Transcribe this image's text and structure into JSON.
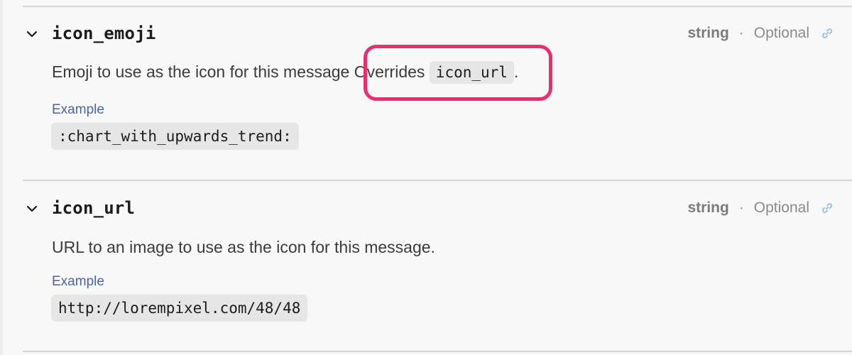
{
  "params": [
    {
      "name": "icon_emoji",
      "type": "string",
      "separator": "·",
      "requirement": "Optional",
      "description_before": "Emoji to use as the icon for this message",
      "description_highlight_text": "Overrides",
      "description_code": "icon_url",
      "description_after": ".",
      "example_label": "Example",
      "example_value": ":chart_with_upwards_trend:"
    },
    {
      "name": "icon_url",
      "type": "string",
      "separator": "·",
      "requirement": "Optional",
      "description": "URL to an image to use as the icon for this message.",
      "example_label": "Example",
      "example_value": "http://lorempixel.com/48/48"
    }
  ],
  "icons": {
    "chevron": "chevron-down-icon",
    "link": "link-icon"
  },
  "colors": {
    "highlight": "#ea2f6c",
    "example_label": "#4a62a8",
    "link_icon": "#8fbfe8"
  }
}
